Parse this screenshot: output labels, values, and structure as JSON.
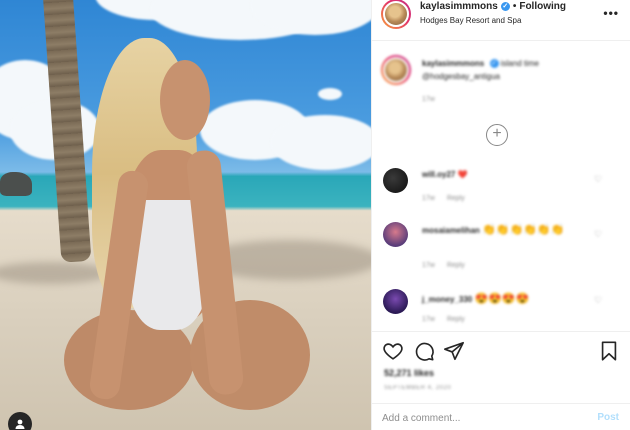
{
  "post": {
    "username": "kaylasimmmons",
    "follow_separator": "•",
    "follow_label": "Following",
    "location": "Hodges Bay Resort and Spa",
    "more_icon": "more-horizontal-icon"
  },
  "caption": {
    "username": "kaylasimmmons",
    "text": "island time",
    "tag": "@hodgesbay_antigua",
    "age": "17w"
  },
  "comments": [
    {
      "username": "will.oy27",
      "text": "❤️",
      "age": "17w",
      "reply": "Reply"
    },
    {
      "username": "mosaiamelihan",
      "text": "👏👏👏👏👏👏",
      "age": "17w",
      "reply": "Reply"
    },
    {
      "username": "j_money_330",
      "text": "😍😍😍😍",
      "age": "17w",
      "reply": "Reply"
    }
  ],
  "actions": {
    "likes": "52,271 likes",
    "date": "SEPTEMBER 4, 2020"
  },
  "add_comment": {
    "placeholder": "Add a comment...",
    "post_label": "Post"
  },
  "colors": {
    "accent": "#3897f0",
    "post_disabled": "#b2dffc",
    "heart_red": "#ed4956",
    "text_secondary": "#8e8e8e"
  }
}
